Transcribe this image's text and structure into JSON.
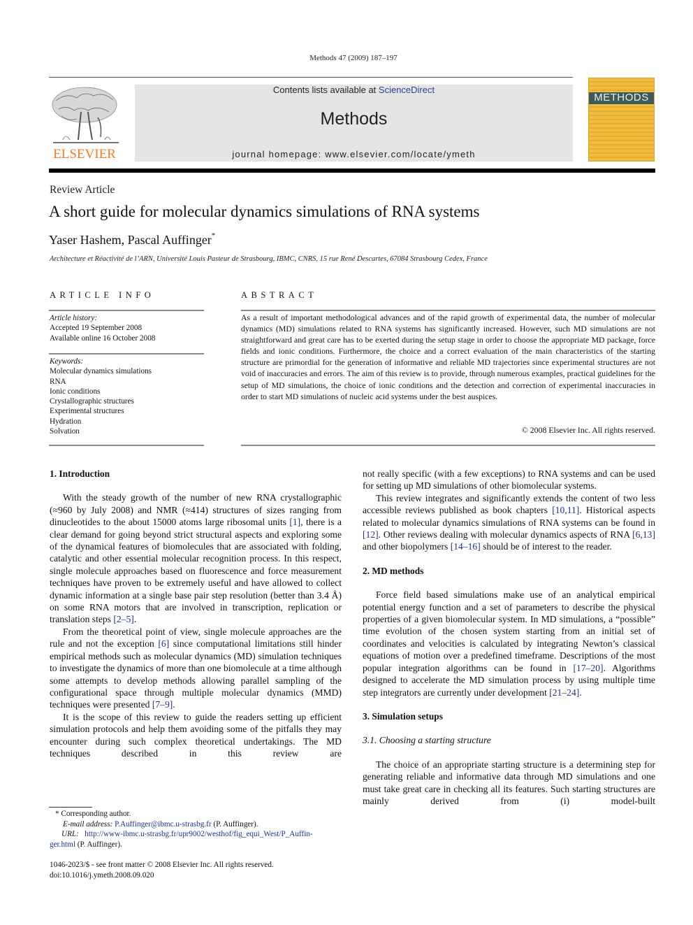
{
  "header": {
    "running_head": "Methods 47 (2009) 187–197",
    "publisher_logo_text": "ELSEVIER",
    "contents_prefix": "Contents lists available at ",
    "contents_link": "ScienceDirect",
    "journal_name": "Methods",
    "homepage_label": "journal homepage: www.elsevier.com/locate/ymeth",
    "cover_title": "METHODS"
  },
  "article": {
    "type": "Review Article",
    "title": "A short guide for molecular dynamics simulations of RNA systems",
    "authors": "Yaser Hashem, Pascal Auffinger",
    "author_mark": "*",
    "affiliation": "Architecture et Réactivité de l’ARN, Université Louis Pasteur de Strasbourg, IBMC, CNRS, 15 rue René Descartes, 67084 Strasbourg Cedex, France"
  },
  "article_info": {
    "heading": "ARTICLE INFO",
    "history_label": "Article history:",
    "history": [
      "Accepted 19 September 2008",
      "Available online 16 October 2008"
    ],
    "keywords_label": "Keywords:",
    "keywords": [
      "Molecular dynamics simulations",
      "RNA",
      "Ionic conditions",
      "Crystallographic structures",
      "Experimental structures",
      "Hydration",
      "Solvation"
    ]
  },
  "abstract": {
    "heading": "ABSTRACT",
    "text": "As a result of important methodological advances and of the rapid growth of experimental data, the number of molecular dynamics (MD) simulations related to RNA systems has significantly increased. However, such MD simulations are not straightforward and great care has to be exerted during the setup stage in order to choose the appropriate MD package, force fields and ionic conditions. Furthermore, the choice and a correct evaluation of the main characteristics of the starting structure are primordial for the generation of informative and reliable MD trajectories since experimental structures are not void of inaccuracies and errors. The aim of this review is to provide, through numerous examples, practical guidelines for the setup of MD simulations, the choice of ionic conditions and the detection and correction of experimental inaccuracies in order to start MD simulations of nucleic acid systems under the best auspices.",
    "copyright": "© 2008 Elsevier Inc. All rights reserved."
  },
  "body": {
    "intro_heading": "1. Introduction",
    "intro_p1": [
      "With the steady growth of the number of new RNA crystallographic (≈960 by July 2008) and NMR (≈414) structures of sizes ranging from dinucleotides to the about 15000 atoms large ribosomal units ",
      "[1]",
      ", there is a clear demand for going beyond strict structural aspects and exploring some of the dynamical features of biomolecules that are associated with folding, catalytic and other essential molecular recognition process. In this respect, single molecule approaches based on fluorescence and force measurement techniques have proven to be extremely useful and have allowed to collect dynamic information at a single base pair step resolution (better than 3.4 Å) on some RNA motors that are involved in transcription, replication or translation steps ",
      "[2–5]",
      "."
    ],
    "intro_p2": [
      "From the theoretical point of view, single molecule approaches are the rule and not the exception ",
      "[6]",
      " since computational limitations still hinder empirical methods such as molecular dynamics (MD) simulation techniques to investigate the dynamics of more than one biomolecule at a time although some attempts to develop methods allowing parallel sampling of the configurational space through multiple molecular dynamics (MMD) techniques were presented ",
      "[7–9]",
      "."
    ],
    "intro_p3": "It is the scope of this review to guide the readers setting up efficient simulation protocols and help them avoiding some of the pitfalls they may encounter during such complex theoretical undertakings. The MD techniques described in this review are",
    "right_p1": "not really specific (with a few exceptions) to RNA systems and can be used for setting up MD simulations of other biomolecular systems.",
    "right_p2": [
      "This review integrates and significantly extends the content of two less accessible reviews published as book chapters ",
      "[10,11]",
      ". Historical aspects related to molecular dynamics simulations of RNA systems can be found in ",
      "[12]",
      ". Other reviews dealing with molecular dynamics aspects of RNA ",
      "[6,13]",
      " and other biopolymers ",
      "[14–16]",
      " should be of interest to the reader."
    ],
    "md_heading": "2. MD methods",
    "md_p1": [
      "Force field based simulations make use of an analytical empirical potential energy function and a set of parameters to describe the physical properties of a given biomolecular system. In MD simulations, a “possible” time evolution of the chosen system starting from an initial set of coordinates and velocities is calculated by integrating Newton’s classical equations of motion over a predefined timeframe. Descriptions of the most popular integration algorithms can be found in ",
      "[17–20]",
      ". Algorithms designed to accelerate the MD simulation process by using multiple time step integrators are currently under development ",
      "[21–24]",
      "."
    ],
    "setup_heading": "3. Simulation setups",
    "setup_subheading": "3.1. Choosing a starting structure",
    "setup_p1": "The choice of an appropriate starting structure is a determining step for generating reliable and informative data through MD simulations and one must take great care in checking all its features. Such starting structures are mainly derived from (i) model-built"
  },
  "footnotes": {
    "corresponding": "* Corresponding author.",
    "email_label": "E-mail address:",
    "email": "P.Auffinger@ibmc.u-strasbg.fr",
    "email_suffix": " (P. Auffinger).",
    "url_label": "URL:",
    "url_part1": "http://www-ibmc.u-strasbg.fr/upr9002/westhof/fig_equi_West/P_Auffin-",
    "url_part2": "ger.html",
    "url_suffix": " (P. Auffinger).",
    "issn_line": "1046-2023/$ - see front matter © 2008 Elsevier Inc. All rights reserved.",
    "doi": "doi:10.1016/j.ymeth.2008.09.020"
  },
  "colors": {
    "link": "#1f2f8f",
    "elsevier_orange": "#f47b20",
    "header_box": "#e5e5e5",
    "cover_yellow": "#f1b93a"
  }
}
